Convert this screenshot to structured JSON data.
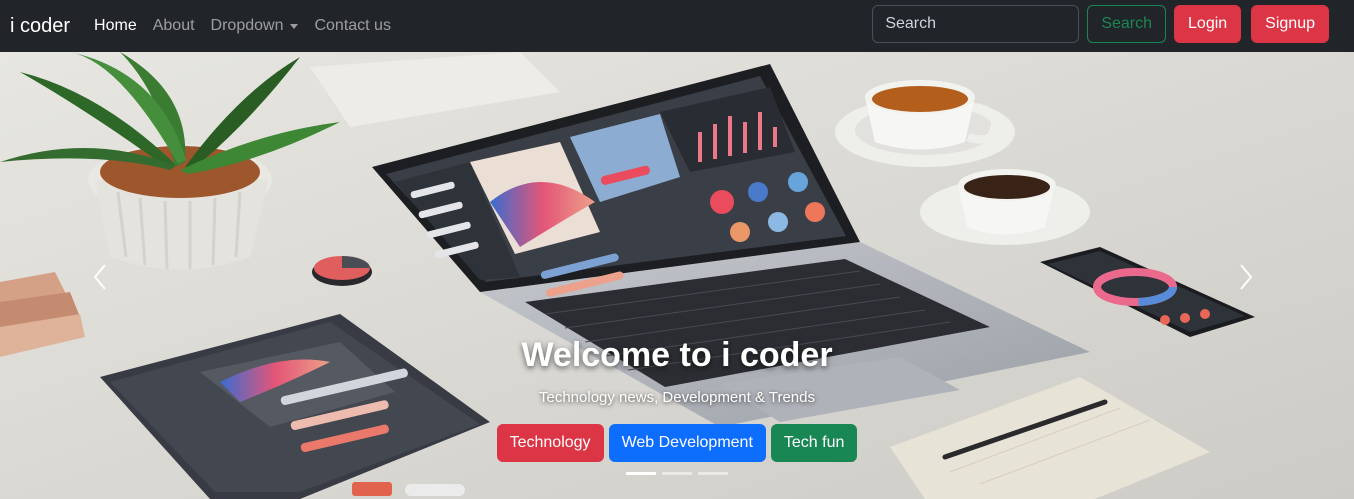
{
  "navbar": {
    "brand": "i coder",
    "links": [
      "Home",
      "About",
      "Dropdown",
      "Contact us"
    ],
    "search": {
      "placeholder": "Search",
      "button": "Search"
    },
    "login": "Login",
    "signup": "Signup"
  },
  "carousel": {
    "title": "Welcome to i coder",
    "subtitle": "Technology news, Development & Trends",
    "buttons": [
      "Technology",
      "Web Development",
      "Tech fun"
    ],
    "active_slide": 1,
    "slide_count": 3
  },
  "colors": {
    "navbar_bg": "#212529",
    "danger": "#dc3545",
    "primary": "#0d6efd",
    "success": "#198754"
  }
}
